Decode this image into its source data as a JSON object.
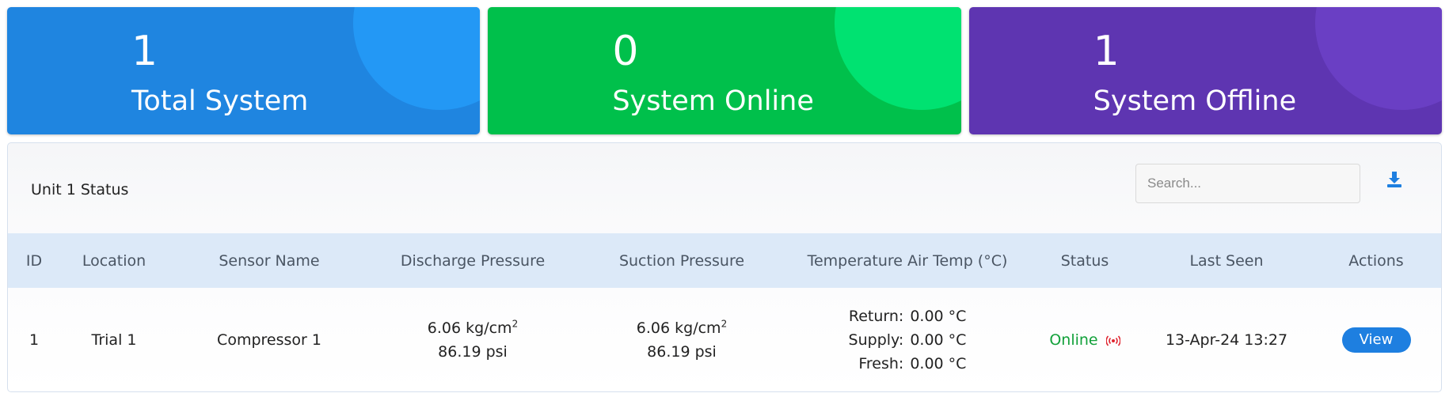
{
  "cards": [
    {
      "count": "1",
      "label": "Total System",
      "color": "#1f85e0"
    },
    {
      "count": "0",
      "label": "System Online",
      "color": "#00c04b"
    },
    {
      "count": "1",
      "label": "System Offline",
      "color": "#5e35b1"
    }
  ],
  "panel": {
    "title": "Unit 1 Status",
    "search_placeholder": "Search...",
    "download_icon": "download-icon"
  },
  "table": {
    "headers": [
      "ID",
      "Location",
      "Sensor Name",
      "Discharge Pressure",
      "Suction Pressure",
      "Temperature Air Temp (°C)",
      "Status",
      "Last Seen",
      "Actions"
    ],
    "rows": [
      {
        "id": "1",
        "location": "Trial 1",
        "sensor_name": "Compressor 1",
        "discharge_kg": "6.06 kg/cm",
        "discharge_kg_sup": "2",
        "discharge_psi": "86.19 psi",
        "suction_kg": "6.06 kg/cm",
        "suction_kg_sup": "2",
        "suction_psi": "86.19 psi",
        "return_label": "Return:",
        "return_value": "0.00 °C",
        "supply_label": "Supply:",
        "supply_value": "0.00 °C",
        "fresh_label": "Fresh:",
        "fresh_value": "0.00 °C",
        "status": "Online",
        "status_color": "#12a13a",
        "last_seen": "13-Apr-24 13:27",
        "action_label": "View"
      }
    ]
  }
}
